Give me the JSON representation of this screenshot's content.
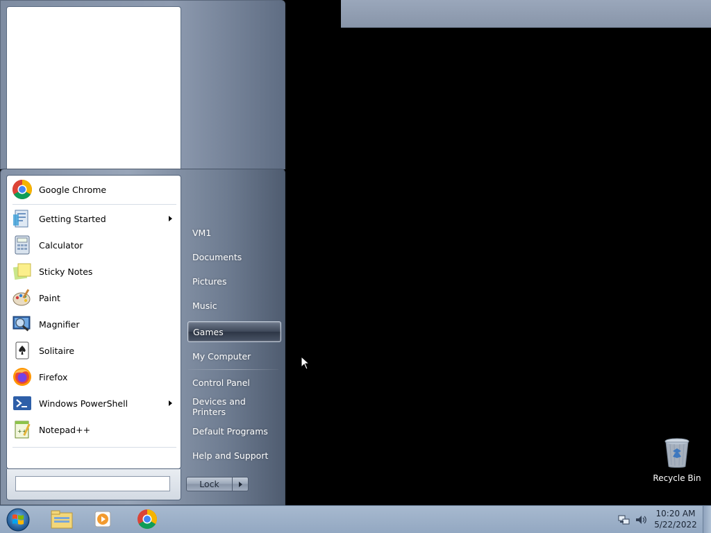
{
  "start_menu": {
    "programs": [
      {
        "label": "Google Chrome",
        "icon": "chrome-icon",
        "has_submenu": false
      },
      {
        "label": "Getting Started",
        "icon": "getting-started-icon",
        "has_submenu": true
      },
      {
        "label": "Calculator",
        "icon": "calculator-icon",
        "has_submenu": false
      },
      {
        "label": "Sticky Notes",
        "icon": "sticky-notes-icon",
        "has_submenu": false
      },
      {
        "label": "Paint",
        "icon": "paint-icon",
        "has_submenu": false
      },
      {
        "label": "Magnifier",
        "icon": "magnifier-icon",
        "has_submenu": false
      },
      {
        "label": "Solitaire",
        "icon": "solitaire-icon",
        "has_submenu": false
      },
      {
        "label": "Firefox",
        "icon": "firefox-icon",
        "has_submenu": false
      },
      {
        "label": "Windows PowerShell",
        "icon": "powershell-icon",
        "has_submenu": true
      },
      {
        "label": "Notepad++",
        "icon": "notepad-plus-plus-icon",
        "has_submenu": false
      }
    ],
    "search": {
      "value": "",
      "placeholder": ""
    },
    "right_items": [
      {
        "label": "VM1"
      },
      {
        "label": "Documents"
      },
      {
        "label": "Pictures"
      },
      {
        "label": "Music"
      },
      {
        "label": "Games",
        "highlighted": true
      },
      {
        "label": "My Computer"
      },
      {
        "label": "Control Panel"
      },
      {
        "label": "Devices and Printers"
      },
      {
        "label": "Default Programs"
      },
      {
        "label": "Help and Support"
      }
    ],
    "lock_label": "Lock"
  },
  "taskbar": {
    "pinned": [
      {
        "name": "Windows Explorer",
        "icon": "file-explorer-icon"
      },
      {
        "name": "Windows Media Player",
        "icon": "media-player-icon"
      },
      {
        "name": "Google Chrome",
        "icon": "chrome-icon"
      }
    ],
    "clock": {
      "time": "10:20 AM",
      "date": "5/22/2022"
    }
  },
  "desktop": {
    "icons": [
      {
        "label": "Recycle Bin",
        "icon": "recycle-bin-icon"
      }
    ]
  },
  "colors": {
    "desktop_bg": "#000000",
    "taskbar": "#a7b9cf",
    "start_menu_frame": "#8391a6",
    "highlight": "#3d4758"
  }
}
